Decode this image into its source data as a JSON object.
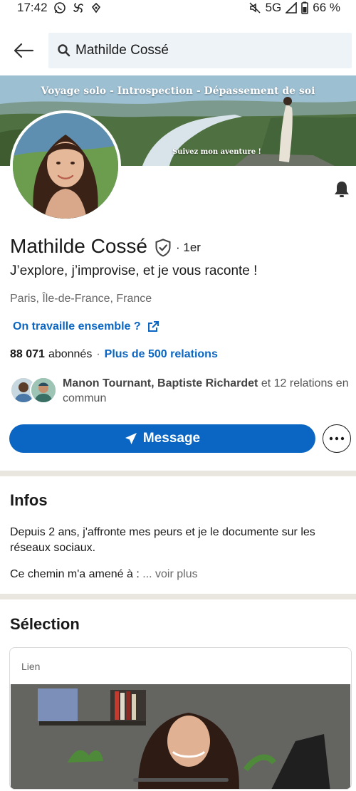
{
  "status_bar": {
    "time": "17:42",
    "network": "5G",
    "battery": "66 %",
    "icons": [
      "whatsapp-icon",
      "pinwheel-icon",
      "notification-icon",
      "mute-icon",
      "signal-icon",
      "battery-icon"
    ]
  },
  "search": {
    "query": "Mathilde Cossé"
  },
  "banner": {
    "title": "Voyage solo - Introspection - Dépassement de soi",
    "subtitle": "Suivez mon aventure !"
  },
  "profile": {
    "name": "Mathilde Cossé",
    "degree": "· 1er",
    "headline": "J’explore, j’improvise, et je vous raconte !",
    "location": "Paris, Île-de-France, France",
    "work_link": "On travaille ensemble ?",
    "followers": "88 071",
    "followers_label": "abonnés",
    "separator": "·",
    "connections": "Plus de 500 relations",
    "mutual_names": "Manon Tournant, Baptiste Richardet",
    "mutual_rest": " et 12 relations en commun"
  },
  "actions": {
    "message": "Message"
  },
  "infos": {
    "title": "Infos",
    "text": "Depuis 2 ans, j'affronte mes peurs et je le documente sur les réseaux sociaux.",
    "more_text": "Ce chemin m'a amené à : ",
    "see_more": "... voir plus"
  },
  "selection": {
    "title": "Sélection",
    "card_label": "Lien"
  },
  "colors": {
    "brand_blue": "#0a66c2",
    "search_bg": "#eef3f8",
    "divider": "#e9e5df"
  }
}
